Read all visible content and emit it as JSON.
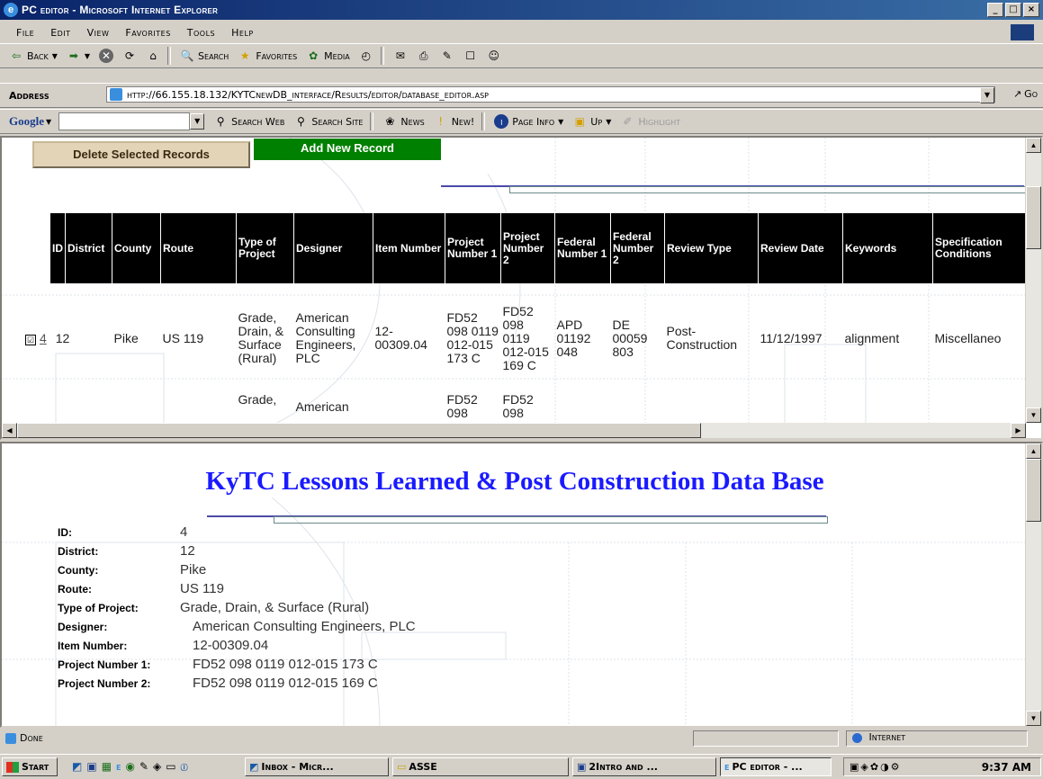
{
  "window": {
    "title": "PC editor - Microsoft Internet Explorer",
    "buttons": [
      "_",
      "□",
      "×"
    ]
  },
  "menu": [
    "File",
    "Edit",
    "View",
    "Favorites",
    "Tools",
    "Help"
  ],
  "nav_toolbar": {
    "back": "Back",
    "search": "Search",
    "favorites": "Favorites",
    "media": "Media"
  },
  "address_bar": {
    "label": "Address",
    "url": "http://66.155.18.132/KYTCnewDB_interface/Results/editor/database_editor.asp",
    "go": "Go"
  },
  "google_bar": {
    "logo": "Google",
    "search_web": "Search Web",
    "search_site": "Search Site",
    "news": "News",
    "new": "New!",
    "page_info": "Page Info",
    "up": "Up",
    "highlight": "Highlight"
  },
  "editor": {
    "delete_button": "Delete Selected Records",
    "add_button": "Add New Record",
    "columns": [
      "ID",
      "District",
      "County",
      "Route",
      "Type of Project",
      "Designer",
      "Item Number",
      "Project Number 1",
      "Project Number 2",
      "Federal Number 1",
      "Federal Number 2",
      "Review Type",
      "Review Date",
      "Keywords",
      "Specification Conditions"
    ],
    "rows": [
      {
        "checked": "☑",
        "id": "4",
        "district": "12",
        "county": "Pike",
        "route": "US 119",
        "type": "Grade, Drain, & Surface (Rural)",
        "designer": "American Consulting Engineers, PLC",
        "item_number": "12-00309.04",
        "project_number_1": "FD52 098 0119 012-015 173 C",
        "project_number_2": "FD52 098 0119 012-015 169 C",
        "federal_number_1": "APD 01192 048",
        "federal_number_2": "DE 00059 803",
        "review_type": "Post-Construction",
        "review_date": "11/12/1997",
        "keywords": "alignment",
        "specification": "Miscellaneo"
      },
      {
        "type": "Grade,",
        "designer": "American",
        "project_number_1": "FD52 098",
        "project_number_2": "FD52 098"
      }
    ]
  },
  "detail": {
    "title": "KyTC Lessons Learned & Post Construction Data Base",
    "fields": [
      {
        "label": "ID:",
        "value": "4"
      },
      {
        "label": "District:",
        "value": "12"
      },
      {
        "label": "County:",
        "value": "Pike"
      },
      {
        "label": "Route:",
        "value": "US 119"
      },
      {
        "label": "Type of Project:",
        "value": "Grade, Drain, & Surface (Rural)"
      },
      {
        "label": "Designer:",
        "value": "American Consulting Engineers, PLC"
      },
      {
        "label": "Item Number:",
        "value": "12-00309.04"
      },
      {
        "label": "Project Number 1:",
        "value": "FD52 098 0119 012-015 173 C"
      },
      {
        "label": "Project Number 2:",
        "value": "FD52 098 0119 012-015 169 C"
      }
    ]
  },
  "status": {
    "text": "Done",
    "zone": "Internet"
  },
  "taskbar": {
    "start": "Start",
    "items": [
      "Inbox - Micr...",
      "ASSE",
      "2Intro and ...",
      "PC editor - ..."
    ],
    "clock": "9:37 AM"
  },
  "colors": {
    "title_gradient_start": "#0a246a",
    "add_button_bg": "#008000",
    "delete_button_bg": "#e3d4b8",
    "db_title": "#1a1aff",
    "table_header_bg": "#000000"
  }
}
